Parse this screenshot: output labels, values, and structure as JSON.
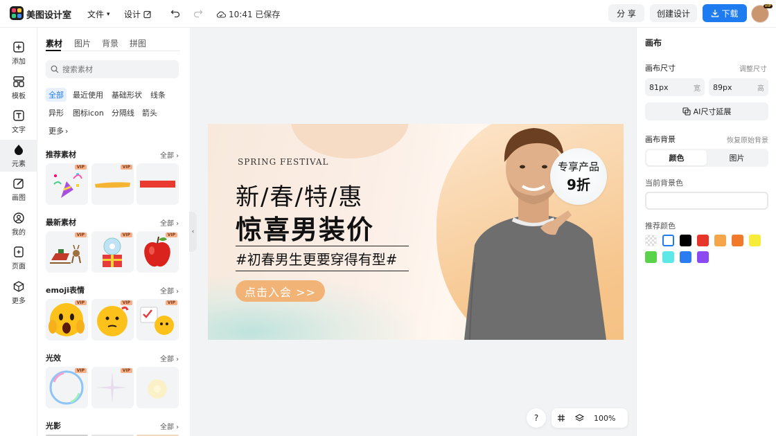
{
  "topbar": {
    "app_name": "美图设计室",
    "file_menu": "文件",
    "design_menu": "设计",
    "saved_status": "10:41 已保存",
    "share_label": "分 享",
    "create_label": "创建设计",
    "download_label": "下载",
    "avatar_badge": "VIP"
  },
  "leftnav": {
    "items": [
      {
        "label": "添加",
        "icon": "plus-square-icon"
      },
      {
        "label": "模板",
        "icon": "template-icon"
      },
      {
        "label": "文字",
        "icon": "text-icon"
      },
      {
        "label": "元素",
        "icon": "shapes-icon"
      },
      {
        "label": "画图",
        "icon": "pencil-icon"
      },
      {
        "label": "我的",
        "icon": "user-icon"
      },
      {
        "label": "页面",
        "icon": "page-add-icon"
      },
      {
        "label": "更多",
        "icon": "cube-icon"
      }
    ],
    "active_index": 3
  },
  "panel": {
    "tabs": [
      "素材",
      "图片",
      "背景",
      "拼图"
    ],
    "search_placeholder": "搜索素材",
    "chips": [
      "全部",
      "最近使用",
      "基础形状",
      "线条",
      "异形",
      "图标icon",
      "分隔线",
      "箭头",
      "更多"
    ],
    "sections": [
      {
        "title": "推荐素材",
        "all": "全部"
      },
      {
        "title": "最新素材",
        "all": "全部"
      },
      {
        "title": "emoji表情",
        "all": "全部"
      },
      {
        "title": "光效",
        "all": "全部"
      },
      {
        "title": "光影",
        "all": "全部"
      }
    ],
    "vip_label": "VIP"
  },
  "design": {
    "subtitle": "SPRING FESTIVAL",
    "line1": "新/春/特/惠",
    "line2": "惊喜男装价",
    "line3": "#初春男生更要穿得有型#",
    "button": "点击入会 >>",
    "badge_line1": "专享产品",
    "badge_line2": "9折"
  },
  "bottombar": {
    "help": "?",
    "zoom": "100%"
  },
  "rightpanel": {
    "title": "画布",
    "size_title": "画布尺寸",
    "resize_link": "调整尺寸",
    "width_value": "81px",
    "width_unit": "宽",
    "height_value": "89px",
    "height_unit": "高",
    "ai_button": "AI尺寸延展",
    "bg_title": "画布背景",
    "restore_link": "恢复原始背景",
    "seg_color": "颜色",
    "seg_image": "图片",
    "current_bg_label": "当前背景色",
    "recommended_label": "推荐颜色",
    "colors": [
      "transparent",
      "#ffffff",
      "#000000",
      "#e8352a",
      "#f5a54a",
      "#f07a2a",
      "#f7ec3a",
      "#5ad24a",
      "#5de8e8",
      "#2a7cf0",
      "#8a4af0"
    ]
  },
  "colors": {
    "accent": "#1f7cf0",
    "canvas_bg": "#f2f3f5"
  }
}
